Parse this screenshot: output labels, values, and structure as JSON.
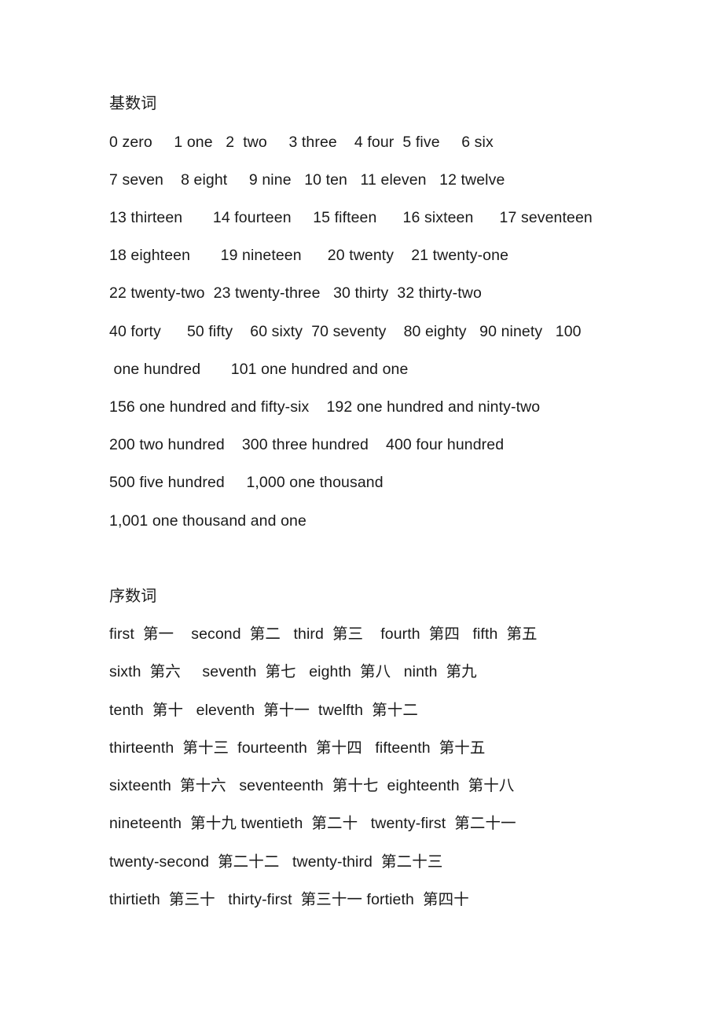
{
  "cardinal": {
    "heading": "基数词",
    "lines": [
      "0 zero     1 one   2  two     3 three    4 four  5 five     6 six",
      "7 seven    8 eight     9 nine   10 ten   11 eleven   12 twelve",
      "13 thirteen       14 fourteen     15 fifteen      16 sixteen      17 seventeen",
      "18 eighteen       19 nineteen      20 twenty    21 twenty-one",
      "22 twenty-two  23 twenty-three   30 thirty  32 thirty-two",
      "40 forty      50 fifty    60 sixty  70 seventy    80 eighty   90 ninety   100",
      " one hundred       101 one hundred and one",
      "156 one hundred and fifty-six    192 one hundred and ninty-two",
      "200 two hundred    300 three hundred    400 four hundred",
      "500 five hundred     1,000 one thousand",
      "1,001 one thousand and one"
    ]
  },
  "ordinal": {
    "heading": "序数词",
    "lines": [
      "first  第一    second  第二   third  第三    fourth  第四   fifth  第五",
      "sixth  第六     seventh  第七   eighth  第八   ninth  第九",
      "tenth  第十   eleventh  第十一  twelfth  第十二",
      "thirteenth  第十三  fourteenth  第十四   fifteenth  第十五",
      "sixteenth  第十六   seventeenth  第十七  eighteenth  第十八",
      "nineteenth  第十九 twentieth  第二十   twenty-first  第二十一",
      "twenty-second  第二十二   twenty-third  第二十三",
      "thirtieth  第三十   thirty-first  第三十一 fortieth  第四十"
    ]
  }
}
